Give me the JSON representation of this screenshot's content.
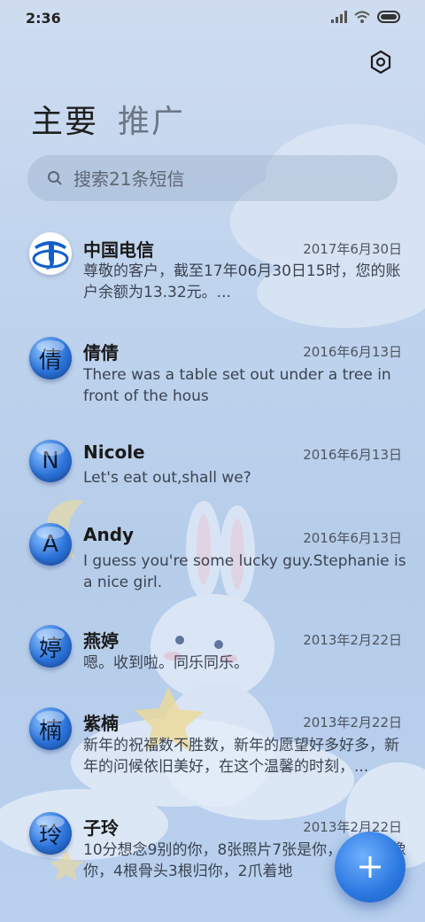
{
  "status_bar": {
    "time": "2:36"
  },
  "tabs": [
    {
      "label": "主要"
    },
    {
      "label": "推广"
    }
  ],
  "search": {
    "placeholder": "搜索21条短信"
  },
  "conversations": [
    {
      "avatar": "",
      "avatar_icon": "china-telecom-logo",
      "name": "中国电信",
      "date": "2017年6月30日",
      "preview": "尊敬的客户，截至17年06月30日15时，您的账户余额为13.32元。..."
    },
    {
      "avatar": "倩",
      "name": "倩倩",
      "date": "2016年6月13日",
      "preview": "There was a table set out under a tree in front of the hous"
    },
    {
      "avatar": "N",
      "name": "Nicole",
      "date": "2016年6月13日",
      "preview": "Let's eat out,shall we?"
    },
    {
      "avatar": "A",
      "name": "Andy",
      "date": "2016年6月13日",
      "preview": "I guess you're some lucky guy.Stephanie is a nice girl."
    },
    {
      "avatar": "婷",
      "name": "燕婷",
      "date": "2013年2月22日",
      "preview": "嗯。收到啦。同乐同乐。"
    },
    {
      "avatar": "楠",
      "name": "紫楠",
      "date": "2013年2月22日",
      "preview": "新年的祝福数不胜数，新年的愿望好多好多，新年的问候依旧美好，在这个温馨的时刻，..."
    },
    {
      "avatar": "玲",
      "name": "子玲",
      "date": "2013年2月22日",
      "preview": "10分想念9别的你，8张照片7张是你，6只5只像你，4根骨头3根归你，2爪着地"
    }
  ],
  "fab": {
    "icon": "plus-icon"
  },
  "colors": {
    "accent": "#2a78e0",
    "background": "#c2d5ee"
  }
}
